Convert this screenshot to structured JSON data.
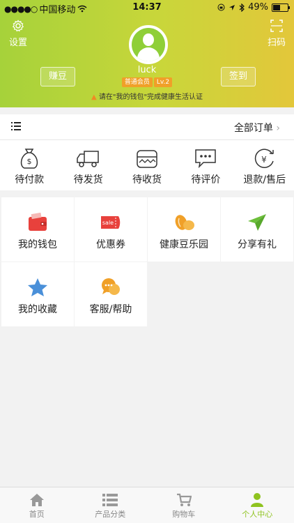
{
  "status_bar": {
    "carrier": "中国移动",
    "time": "14:37",
    "battery": "49%",
    "battery_level": 0.49
  },
  "header": {
    "settings_label": "设置",
    "scan_label": "扫码",
    "username": "luck",
    "member_level": "普通会员",
    "level_badge": "Lv.2",
    "earn_beans_label": "赚豆",
    "checkin_label": "签到",
    "notice": "请在\"我的钱包\"完成健康生活认证"
  },
  "orders": {
    "all_orders_label": "全部订单",
    "items": [
      {
        "label": "待付款",
        "icon": "money-bag-icon"
      },
      {
        "label": "待发货",
        "icon": "truck-icon"
      },
      {
        "label": "待收货",
        "icon": "box-icon"
      },
      {
        "label": "待评价",
        "icon": "comment-icon"
      },
      {
        "label": "退款/售后",
        "icon": "refund-icon"
      }
    ]
  },
  "features": [
    {
      "label": "我的钱包",
      "icon": "wallet-icon",
      "color": "#e8413c"
    },
    {
      "label": "优惠券",
      "icon": "coupon-icon",
      "color": "#e8413c",
      "icon_text": "sale"
    },
    {
      "label": "健康豆乐园",
      "icon": "beans-icon",
      "color": "#f0a028"
    },
    {
      "label": "分享有礼",
      "icon": "paper-plane-icon",
      "color": "#6cbf3a"
    },
    {
      "label": "我的收藏",
      "icon": "star-icon",
      "color": "#4a90d9"
    },
    {
      "label": "客服/帮助",
      "icon": "chat-icon",
      "color": "#f0a028"
    }
  ],
  "tabbar": [
    {
      "label": "首页",
      "icon": "home-icon",
      "active": false
    },
    {
      "label": "产品分类",
      "icon": "category-icon",
      "active": false
    },
    {
      "label": "购物车",
      "icon": "cart-icon",
      "active": false
    },
    {
      "label": "个人中心",
      "icon": "person-icon",
      "active": true
    }
  ],
  "colors": {
    "accent": "#8fc31f",
    "header_start": "#a6d23a",
    "header_end": "#e3c73a"
  }
}
